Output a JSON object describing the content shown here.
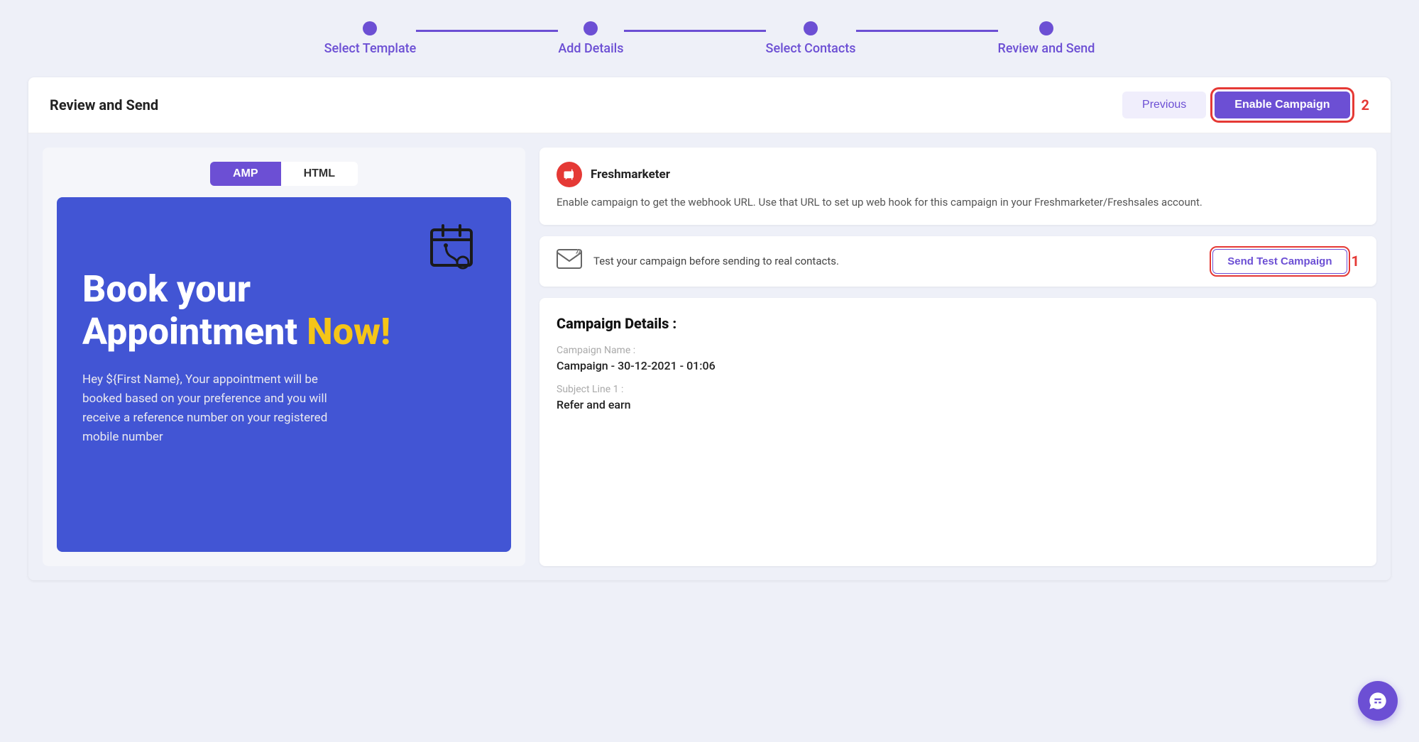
{
  "stepper": {
    "steps": [
      {
        "label": "Select Template"
      },
      {
        "label": "Add Details"
      },
      {
        "label": "Select Contacts"
      },
      {
        "label": "Review and Send"
      }
    ]
  },
  "header": {
    "title": "Review and Send",
    "btn_previous": "Previous",
    "btn_enable": "Enable Campaign",
    "badge": "2"
  },
  "tabs": {
    "amp": "AMP",
    "html": "HTML"
  },
  "preview": {
    "line1": "Book your",
    "line2": "Appointment ",
    "line2_highlight": "Now!",
    "body": "Hey ${First Name}, Your appointment will be booked based on your preference and you will receive a reference number on your registered mobile number"
  },
  "freshmarketer": {
    "brand": "Freshmarketer",
    "description": "Enable campaign to get the webhook URL. Use that URL to set up web hook for this campaign in your Freshmarketer/Freshsales account."
  },
  "test_campaign": {
    "text": "Test your campaign before sending to real contacts.",
    "btn_label": "Send Test Campaign",
    "badge": "1"
  },
  "campaign_details": {
    "title": "Campaign Details :",
    "name_label": "Campaign Name :",
    "name_value": "Campaign - 30-12-2021 - 01:06",
    "subject_label": "Subject Line 1 :",
    "subject_value": "Refer and earn"
  }
}
